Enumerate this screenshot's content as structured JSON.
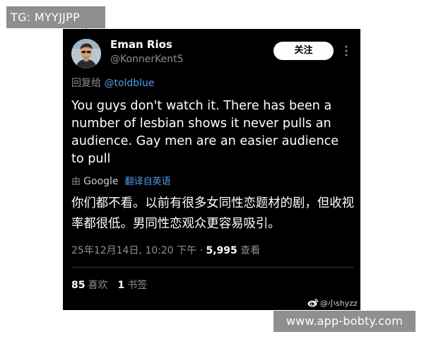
{
  "top_tag": "TG: MYYJJPP",
  "bottom_tag": "www.app-bobty.com",
  "tweet": {
    "display_name": "Eman Rios",
    "handle": "@KonnerKent5",
    "follow_label": "关注",
    "reply_prefix": "回复给",
    "reply_to": "@toldblue",
    "text": "You guys don't watch it. There has been a number of lesbian shows it never pulls an audience. Gay men are an easier audience to pull",
    "translate_by": "由",
    "translate_brand": "Google",
    "translate_link": "翻译自英语",
    "translated_text": "你们都不看。以前有很多女同性恋题材的剧，但收视率都很低。男同性恋观众更容易吸引。",
    "timestamp": "25年12月14日, 10:20 下午",
    "separator": "·",
    "view_count": "5,995",
    "view_label": "查看",
    "likes_count": "85",
    "likes_label": "喜欢",
    "bookmarks_count": "1",
    "bookmarks_label": "书签"
  },
  "watermark": "@小shyzz",
  "colors": {
    "card_bg": "#000000",
    "tag_bg": "#8f8f8f",
    "link_blue": "#4f9fe8",
    "secondary_text": "#8b8f94"
  },
  "icons": {
    "more": "more-vertical-icon",
    "weibo": "weibo-logo-icon",
    "avatar": "user-avatar"
  }
}
